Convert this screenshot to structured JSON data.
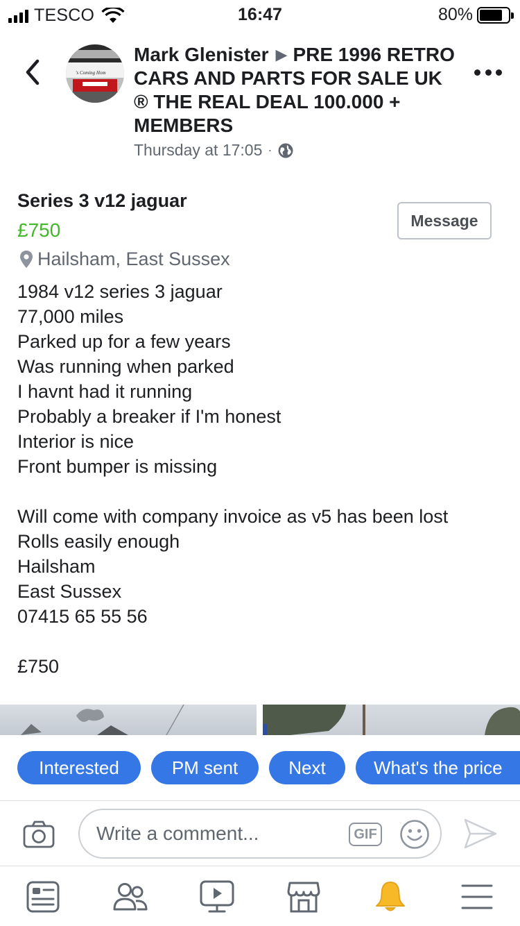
{
  "status_bar": {
    "carrier": "TESCO",
    "time": "16:47",
    "battery": "80%",
    "battery_level": 0.8
  },
  "post": {
    "author": "Mark Glenister",
    "group": "PRE 1996 RETRO CARS AND PARTS FOR SALE UK ® THE REAL DEAL 100.000 + MEMBERS",
    "timestamp": "Thursday at 17:05",
    "avatar_text": "'s Coming Hom"
  },
  "listing": {
    "title": "Series 3 v12 jaguar",
    "price": "£750",
    "location": "Hailsham, East Sussex",
    "message_label": "Message",
    "description": [
      "1984 v12 series 3 jaguar",
      "77,000 miles",
      "Parked up for a few years",
      "Was running when parked",
      "I havnt had it running",
      "Probably a breaker if I'm honest",
      "Interior is nice",
      "Front bumper is missing",
      "",
      "Will come with company invoice as v5 has been lost",
      "Rolls easily enough",
      "Hailsham",
      "East Sussex",
      "07415 65 55 56",
      "",
      "£750"
    ]
  },
  "quick_replies": [
    "Interested",
    "PM sent",
    "Next",
    "What's the price"
  ],
  "composer": {
    "placeholder": "Write a comment...",
    "gif_label": "GIF"
  },
  "tab_bar": [
    "news-feed-icon",
    "groups-icon",
    "watch-icon",
    "marketplace-icon",
    "notifications-icon",
    "menu-icon"
  ],
  "colors": {
    "accent": "#3578e5",
    "price": "#42b72a",
    "notification": "#f7b928",
    "secondary_text": "#606770"
  }
}
